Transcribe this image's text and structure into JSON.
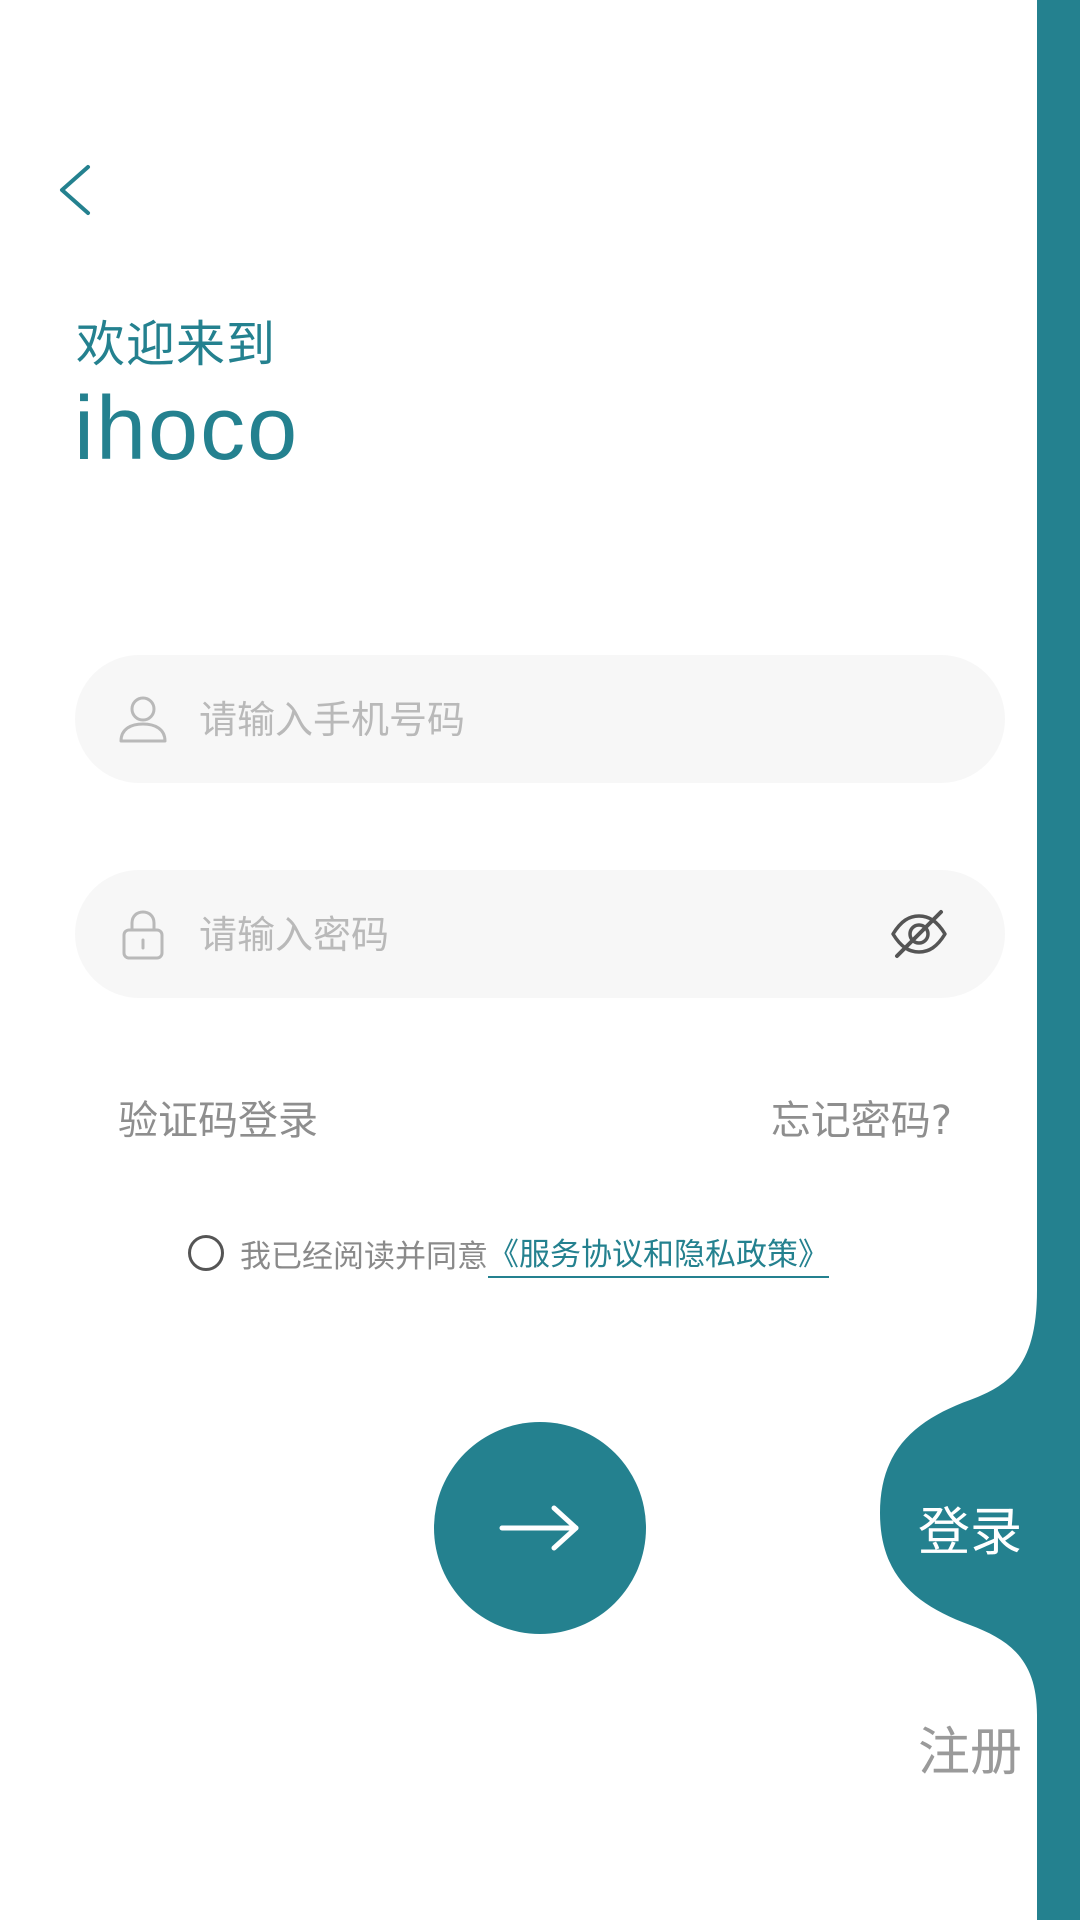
{
  "colors": {
    "accent": "#24818f",
    "field_bg": "#f7f7f7",
    "placeholder": "#b9b9b9",
    "muted_text": "#8e8e8e"
  },
  "header": {
    "back_icon": "chevron-left-icon",
    "welcome": "欢迎来到",
    "app_name": "ihoco"
  },
  "form": {
    "phone": {
      "icon": "user-icon",
      "placeholder": "请输入手机号码",
      "value": ""
    },
    "password": {
      "icon": "lock-icon",
      "placeholder": "请输入密码",
      "value": "",
      "toggle_icon": "eye-hidden-icon"
    },
    "sms_login_label": "验证码登录",
    "forgot_password_label": "忘记密码?",
    "agreement": {
      "checked": false,
      "text": "我已经阅读并同意",
      "link_text": "《服务协议和隐私政策》"
    },
    "submit_icon": "arrow-right-icon"
  },
  "side_tabs": {
    "login_label": "登录",
    "register_label": "注册",
    "active": "login"
  }
}
